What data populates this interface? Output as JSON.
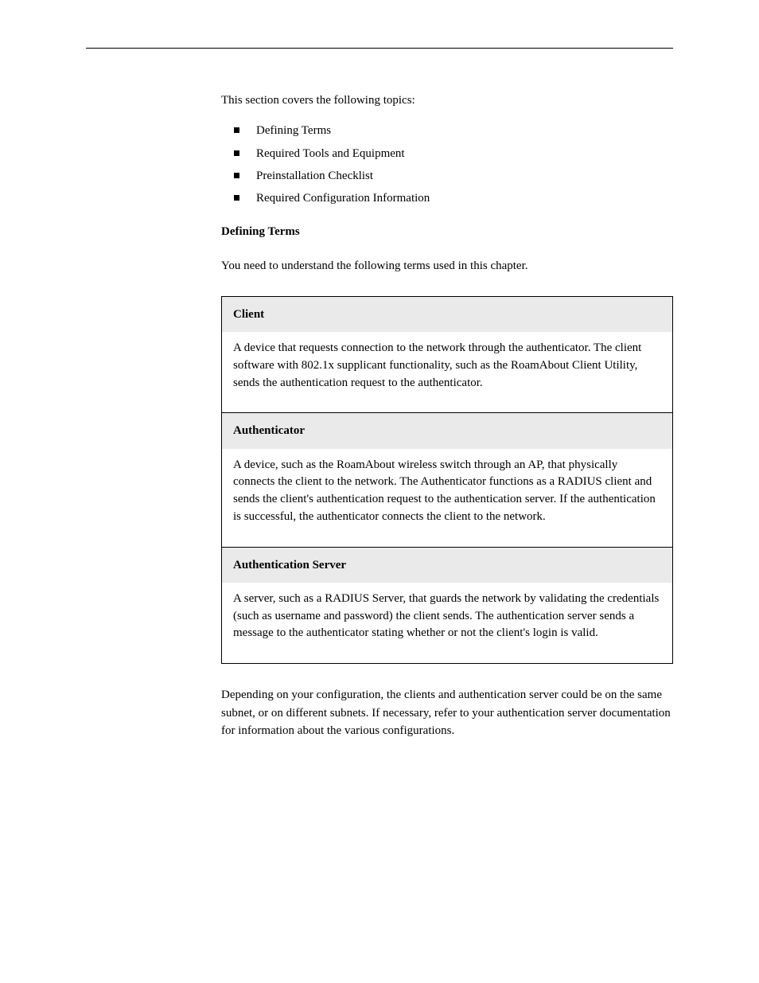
{
  "intro": "This section covers the following topics:",
  "bullets": [
    "Defining Terms",
    "Required Tools and Equipment",
    "Preinstallation Checklist",
    "Required Configuration Information"
  ],
  "heading": "Defining Terms",
  "transition": "You need to understand the following terms used in this chapter.",
  "table": [
    {
      "term": "Client",
      "definition": "A device that requests connection to the network through the authenticator. The client software with 802.1x supplicant functionality, such as the RoamAbout Client Utility, sends the authentication request to the authenticator."
    },
    {
      "term": "Authenticator",
      "definition": "A device, such as the RoamAbout wireless switch through an AP, that physically connects the client to the network. The Authenticator functions as a RADIUS client and sends the client's authentication request to the authentication server. If the authentication is successful, the authenticator connects the client to the network."
    },
    {
      "term": "Authentication Server",
      "definition": "A server, such as a RADIUS Server, that guards the network by validating the credentials (such as username and password) the client sends. The authentication server sends a message to the authenticator stating whether or not the client's login is valid."
    }
  ],
  "after_table": "Depending on your configuration, the clients and authentication server could be on the same subnet, or on different subnets. If necessary, refer to your authentication server documentation for information about the various configurations."
}
